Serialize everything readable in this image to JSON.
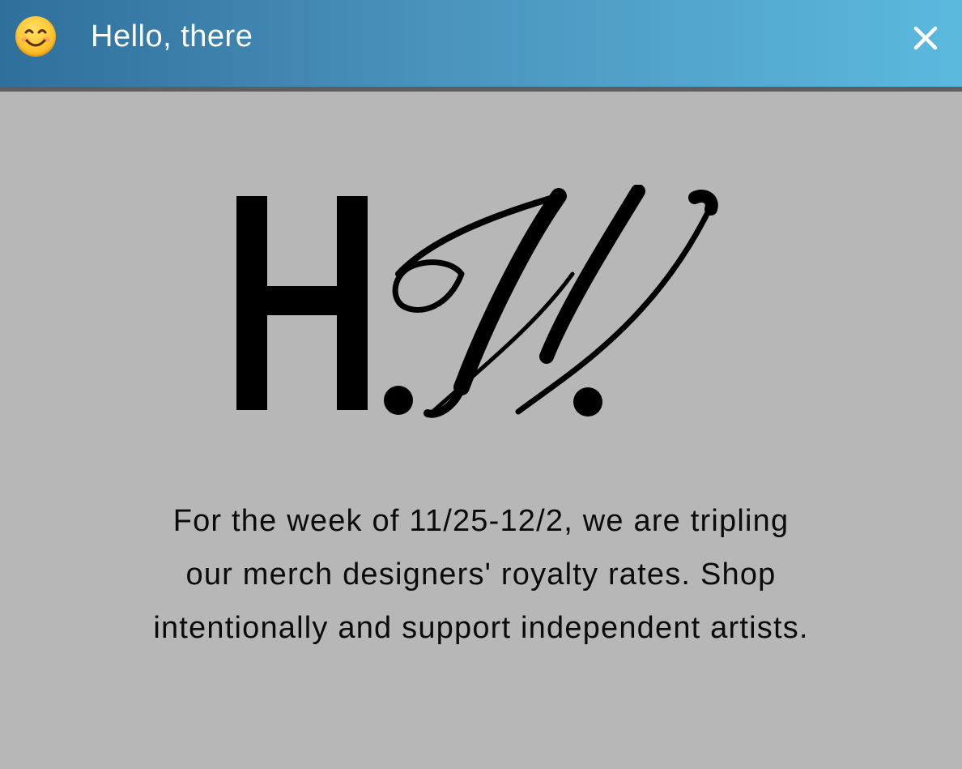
{
  "titlebar": {
    "icon": "smiling-face-emoji",
    "title": "Hello, there",
    "close_icon": "close-x-icon",
    "gradient_start": "#2f6f9c",
    "gradient_end": "#5bb9de"
  },
  "logo": {
    "letters": "H.W."
  },
  "message": {
    "lines": [
      "For the week of 11/25-12/2, we are tripling",
      "our merch designers' royalty rates. Shop",
      "intentionally and support independent artists."
    ]
  },
  "colors": {
    "background": "#b7b7b7",
    "text": "#0b0b0b"
  }
}
